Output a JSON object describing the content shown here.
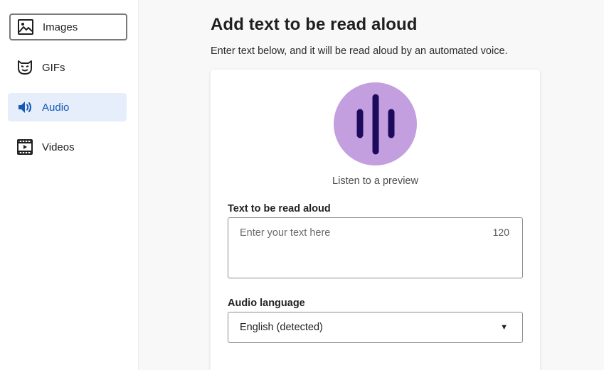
{
  "sidebar": {
    "items": [
      {
        "label": "Images",
        "icon": "image-icon",
        "state": "focused"
      },
      {
        "label": "GIFs",
        "icon": "gif-face-icon",
        "state": "default"
      },
      {
        "label": "Audio",
        "icon": "speaker-icon",
        "state": "active"
      },
      {
        "label": "Videos",
        "icon": "film-icon",
        "state": "default"
      }
    ]
  },
  "main": {
    "title": "Add text to be read aloud",
    "subtitle": "Enter text below, and it will be read aloud by an automated voice.",
    "preview": {
      "icon": "audio-wave-icon",
      "label": "Listen to a preview",
      "color": "#c39fdf"
    },
    "text_field": {
      "label": "Text to be read aloud",
      "placeholder": "Enter your text here",
      "value": "",
      "char_count": "120"
    },
    "language_field": {
      "label": "Audio language",
      "selected": "English (detected)"
    }
  },
  "colors": {
    "accent": "#1459b8",
    "active_bg": "#e5eefa",
    "preview_circle": "#c39fdf",
    "wave": "#1e0a5c"
  }
}
